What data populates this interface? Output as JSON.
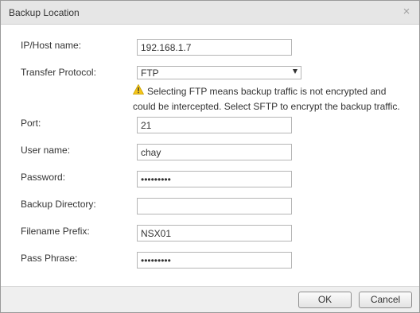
{
  "dialog": {
    "title": "Backup Location",
    "close_glyph": "×"
  },
  "fields": {
    "host": {
      "label": "IP/Host name:",
      "value": "192.168.1.7"
    },
    "protocol": {
      "label": "Transfer Protocol:",
      "selected": "FTP",
      "warning_icon": "warning-triangle-icon",
      "warning": "Selecting FTP means backup traffic is not encrypted and could be intercepted. Select SFTP to encrypt the backup traffic."
    },
    "port": {
      "label": "Port:",
      "value": "21"
    },
    "username": {
      "label": "User name:",
      "value": "chay"
    },
    "password": {
      "label": "Password:",
      "value": "•••••••••"
    },
    "directory": {
      "label": "Backup Directory:",
      "value": ""
    },
    "prefix": {
      "label": "Filename Prefix:",
      "value": "NSX01"
    },
    "passphrase": {
      "label": "Pass Phrase:",
      "value": "•••••••••"
    }
  },
  "buttons": {
    "ok": "OK",
    "cancel": "Cancel"
  },
  "colors": {
    "warning_fill": "#f5c518",
    "titlebar_bg": "#e6e6e6",
    "footer_bg": "#efefef"
  }
}
